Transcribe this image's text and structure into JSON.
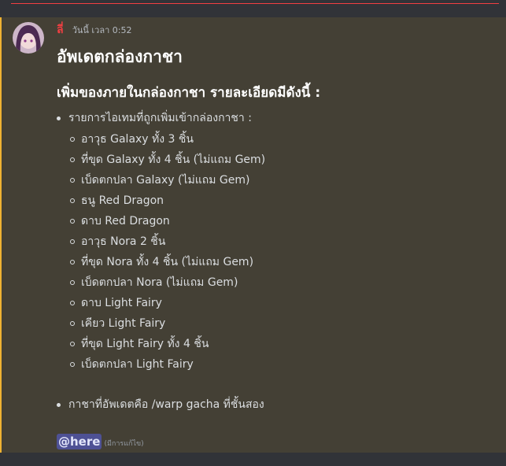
{
  "message": {
    "username": "ลี่",
    "timestamp": "วันนี้ เวลา 0:52",
    "title": "อัพเดตกล่องกาชา",
    "subtitle": "เพิ่มของภายในกล่องกาชา รายละเอียดมีดังนี้ :",
    "list_header": "รายการไอเทมที่ถูกเพิ่มเข้ากล่องกาชา :",
    "items": [
      "อาวุธ Galaxy ทั้ง 3 ชิ้น",
      "ที่ขุด Galaxy ทั้ง 4 ชิ้น (ไม่แถม Gem)",
      "เบ็ดตกปลา Galaxy (ไม่แถม Gem)",
      "ธนู Red Dragon",
      "ดาบ Red Dragon",
      "อาวุธ Nora 2 ชิ้น",
      "ที่ขุด Nora ทั้ง 4 ชิ้น (ไม่แถม Gem)",
      "เบ็ดตกปลา Nora (ไม่แถม Gem)",
      "ดาบ Light Fairy",
      "เคียว Light Fairy",
      "ที่ขุด Light Fairy ทั้ง 4 ชิ้น",
      "เบ็ดตกปลา Light Fairy"
    ],
    "location_note": "กาชาที่อัพเดตคือ /warp gacha ที่ชั้นสอง",
    "mention": "@here",
    "edited": "(มีการแก้ไข)"
  },
  "colors": {
    "highlight_bg": "#444035",
    "highlight_border": "#f0b232",
    "username": "#f23f42",
    "mention_bg": "#4e5195"
  }
}
